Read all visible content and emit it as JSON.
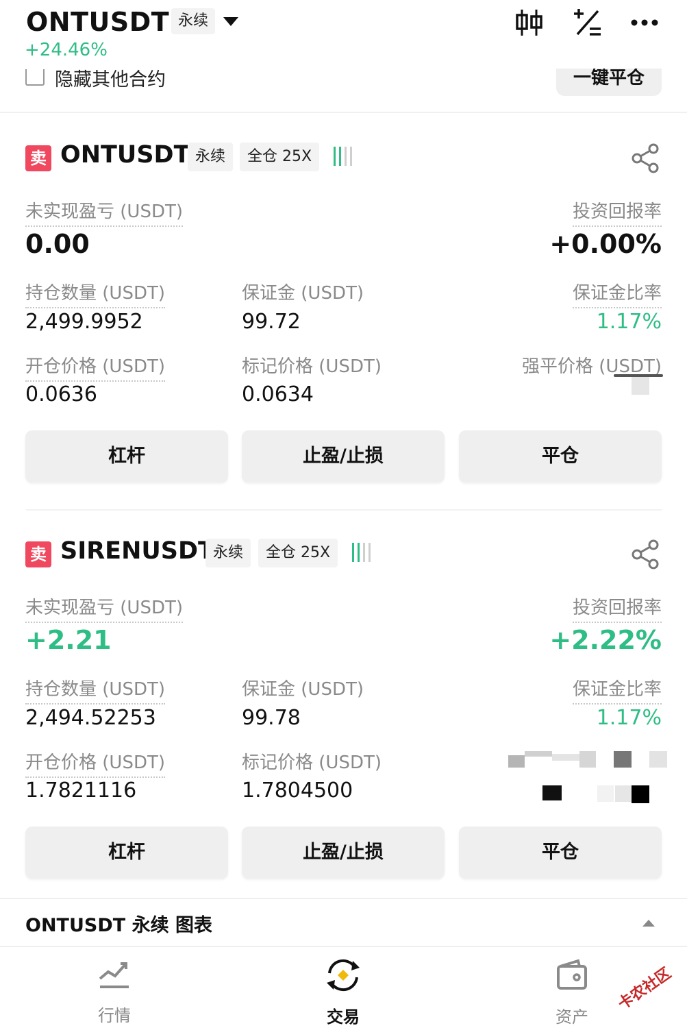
{
  "header": {
    "symbol": "ONTUSDT",
    "contract_tag": "永续",
    "change": "+24.46%",
    "hide_other_label": "隐藏其他合约",
    "close_all_label": "一键平仓"
  },
  "positions": [
    {
      "side": "卖",
      "symbol": "ONTUSDT",
      "tag_type": "永续",
      "tag_margin": "全仓 25X",
      "unrealized_label": "未实现盈亏 (USDT)",
      "unrealized_value": "0.00",
      "roe_label": "投资回报率",
      "roe_value": "+0.00%",
      "size_label": "持仓数量 (USDT)",
      "size_value": "2,499.9952",
      "margin_label": "保证金 (USDT)",
      "margin_value": "99.72",
      "margin_ratio_label": "保证金比率",
      "margin_ratio_value": "1.17%",
      "entry_label": "开仓价格 (USDT)",
      "entry_value": "0.0636",
      "mark_label": "标记价格 (USDT)",
      "mark_value": "0.0634",
      "liq_label": "强平价格 (USDT)",
      "btn_leverage": "杠杆",
      "btn_tpsl": "止盈/止损",
      "btn_close": "平仓"
    },
    {
      "side": "卖",
      "symbol": "SIRENUSDT",
      "tag_type": "永续",
      "tag_margin": "全仓 25X",
      "unrealized_label": "未实现盈亏 (USDT)",
      "unrealized_value": "+2.21",
      "roe_label": "投资回报率",
      "roe_value": "+2.22%",
      "size_label": "持仓数量 (USDT)",
      "size_value": "2,494.52253",
      "margin_label": "保证金 (USDT)",
      "margin_value": "99.78",
      "margin_ratio_label": "保证金比率",
      "margin_ratio_value": "1.17%",
      "entry_label": "开仓价格 (USDT)",
      "entry_value": "1.7821116",
      "mark_label": "标记价格 (USDT)",
      "mark_value": "1.7804500",
      "btn_leverage": "杠杆",
      "btn_tpsl": "止盈/止损",
      "btn_close": "平仓"
    }
  ],
  "chart_bar": {
    "label": "ONTUSDT 永续 图表"
  },
  "nav": [
    {
      "label": "行情",
      "icon": "market-chart-icon"
    },
    {
      "label": "交易",
      "icon": "trade-swap-icon"
    },
    {
      "label": "资产",
      "icon": "wallet-icon"
    }
  ],
  "watermark": "卡农社区",
  "colors": {
    "green": "#2ebd85",
    "red": "#f0485f",
    "button": "#efefef"
  }
}
